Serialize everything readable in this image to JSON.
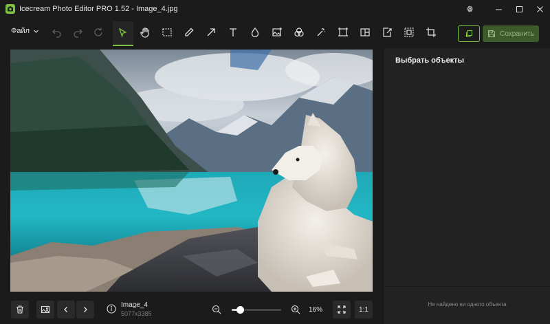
{
  "window": {
    "title": "Icecream Photo Editor PRO 1.52 - Image_4.jpg"
  },
  "toolbar": {
    "file_label": "Файл",
    "save_label": "Сохранить",
    "tools": [
      "undo-icon",
      "redo-icon",
      "reset-icon",
      "select-icon",
      "hand-icon",
      "marquee-icon",
      "pencil-icon",
      "arrow-icon",
      "text-icon",
      "drop-icon",
      "image-insert-icon",
      "color-filters-icon",
      "magic-wand-icon",
      "resize-icon",
      "split-icon",
      "export-icon",
      "select-area-icon",
      "crop-icon"
    ],
    "active_tool": "select-icon"
  },
  "right_panel": {
    "title": "Выбрать объекты",
    "empty_message": "Не найдено ни одного объекта"
  },
  "bottom": {
    "image_name": "Image_4",
    "image_dimensions": "5077x3385",
    "zoom_value": "16%",
    "zoom_fraction": 0.16,
    "ratio_label": "1:1"
  },
  "colors": {
    "accent": "#7dc242",
    "background": "#1b1b1b",
    "panel": "#222222"
  }
}
